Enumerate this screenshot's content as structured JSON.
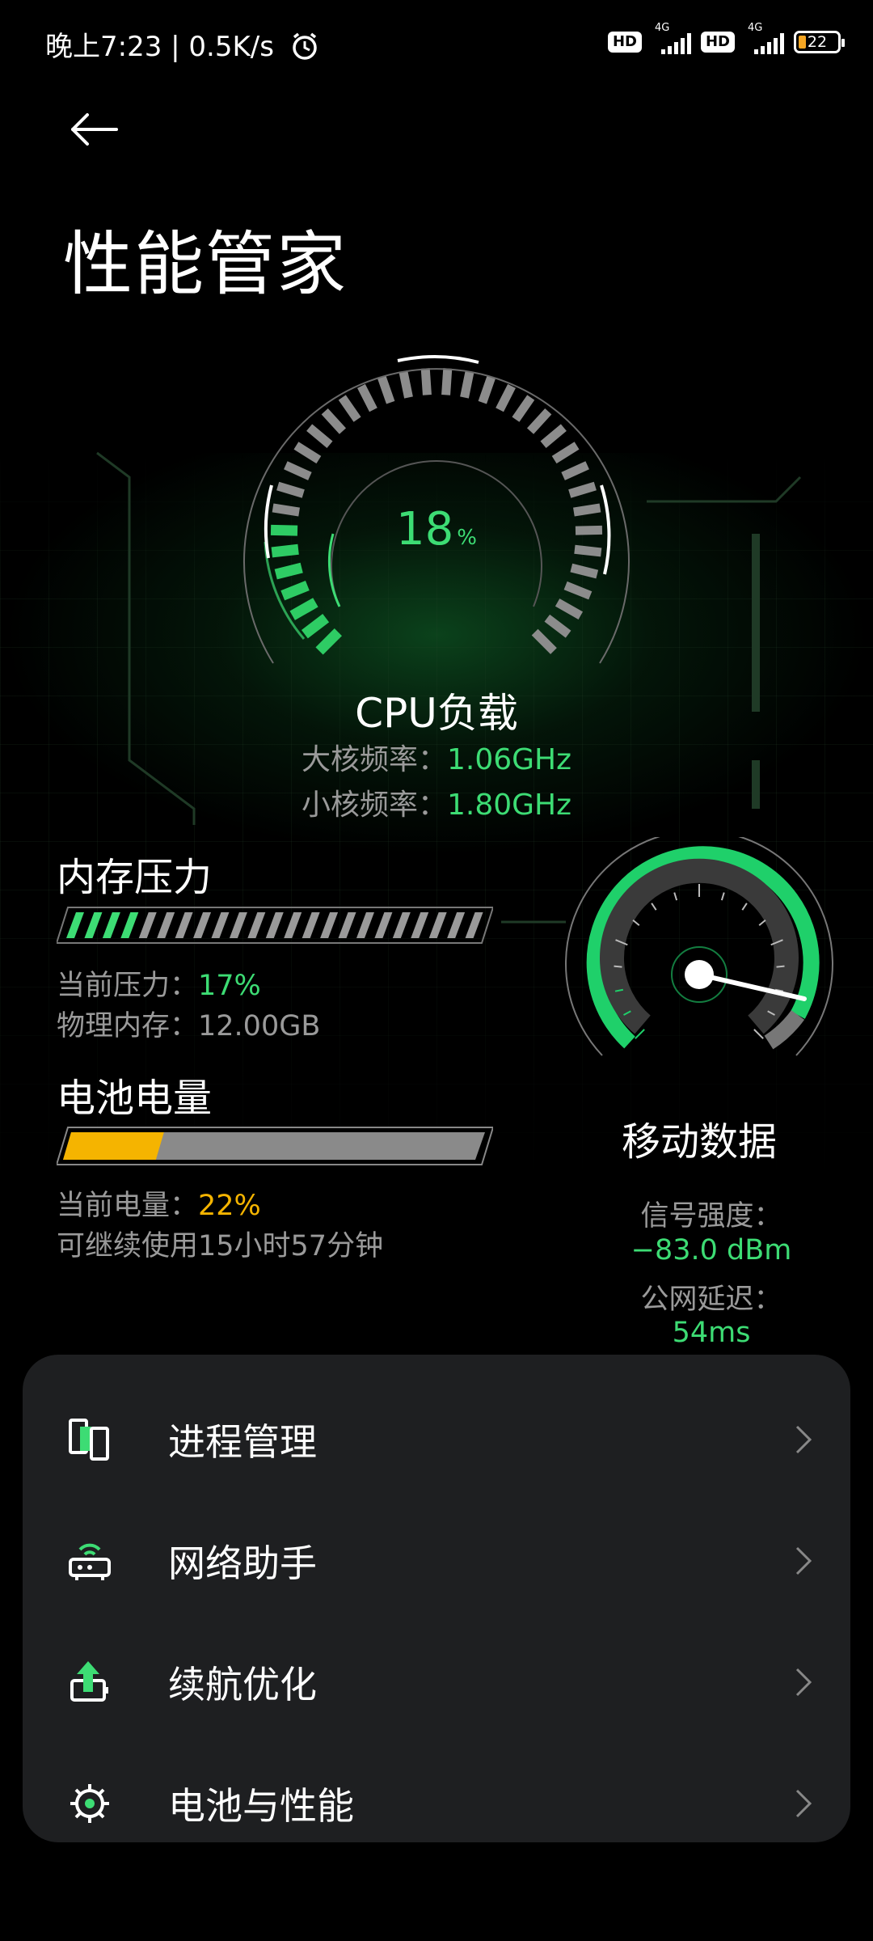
{
  "status_bar": {
    "time": "晚上7:23 | 0.5K/s",
    "hd_badge_1": "HD",
    "network_1": "4G",
    "hd_badge_2": "HD",
    "network_2": "4G",
    "battery_percent": "22",
    "alarm_icon": "alarm-clock-icon",
    "battery_color": "#f5a623"
  },
  "header": {
    "title": "性能管家",
    "back_icon": "arrow-left-icon"
  },
  "cpu": {
    "load_value": "18",
    "load_unit": "%",
    "load_percent": 18,
    "label": "CPU负载",
    "big_core_label": "大核频率：",
    "big_core_value": "1.06GHz",
    "small_core_label": "小核频率：",
    "small_core_value": "1.80GHz"
  },
  "memory": {
    "title": "内存压力",
    "pressure_label": "当前压力：",
    "pressure_value": "17%",
    "pressure_fraction": 0.17,
    "physical_label": "物理内存：",
    "physical_value": "12.00GB"
  },
  "battery": {
    "title": "电池电量",
    "level_label": "当前电量：",
    "level_value": "22%",
    "level_fraction": 0.22,
    "remaining": "可继续使用15小时57分钟"
  },
  "mobile_data": {
    "label": "移动数据",
    "signal_label": "信号强度：",
    "signal_value": "−83.0 dBm",
    "latency_label": "公网延迟：",
    "latency_value": "54ms"
  },
  "menu": {
    "items": [
      {
        "label": "进程管理",
        "icon": "process-manager-icon"
      },
      {
        "label": "网络助手",
        "icon": "network-router-icon"
      },
      {
        "label": "续航优化",
        "icon": "battery-boost-icon"
      },
      {
        "label": "电池与性能",
        "icon": "gear-icon"
      }
    ]
  },
  "colors": {
    "accent_green": "#3ddc74",
    "accent_yellow": "#f5b400",
    "card_background": "#1e1f21"
  }
}
